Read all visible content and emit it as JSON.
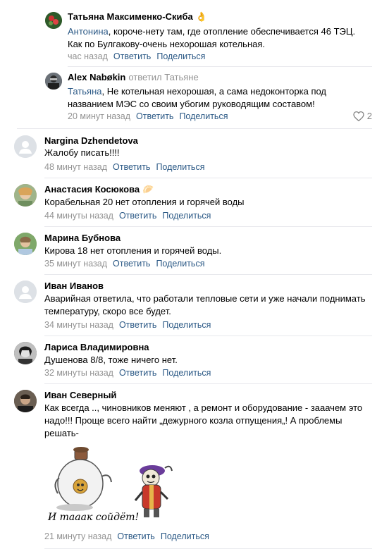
{
  "comments": [
    {
      "author": "Татьяна Максименко-Скиба",
      "emoji": "👌",
      "mention": "Антонина",
      "text_line1": ", короче-нету там, где отопление обеспечивается 46 ТЭЦ.",
      "text_line2": "Как по Булгакову-очень нехорошая котельная.",
      "time": "час назад",
      "reply_label": "Ответить",
      "share_label": "Поделиться"
    },
    {
      "author": "Alex Nabøkin",
      "replied_to": "ответил Татьяне",
      "mention": "Татьяна",
      "text_line1": ", Не котельная нехорошая, а сама недоконторка под",
      "text_line2": "названием МЭС со своим убогим руководящим составом!",
      "time": "20 минут назад",
      "reply_label": "Ответить",
      "share_label": "Поделиться",
      "likes": "2"
    },
    {
      "author": "Nargina Dzhendetova",
      "text_line1": "Жалобу писать!!!!",
      "time": "48 минут назад",
      "reply_label": "Ответить",
      "share_label": "Поделиться"
    },
    {
      "author": "Анастасия Косюкова",
      "emoji": "🥟",
      "text_line1": "Корабельная 20 нет отопления и горячей воды",
      "time": "44 минуты назад",
      "reply_label": "Ответить",
      "share_label": "Поделиться"
    },
    {
      "author": "Марина Бубнова",
      "text_line1": "Кирова 18 нет отопления и горячей воды.",
      "time": "35 минут назад",
      "reply_label": "Ответить",
      "share_label": "Поделиться"
    },
    {
      "author": "Иван Иванов",
      "text_line1": "Аварийная ответила, что работали тепловые сети и уже начали поднимать",
      "text_line2": "температуру, скоро все будет.",
      "time": "34 минуты назад",
      "reply_label": "Ответить",
      "share_label": "Поделиться"
    },
    {
      "author": "Лариса Владимировна",
      "text_line1": "Душенова 8/8, тоже ничего нет.",
      "time": "32 минуты назад",
      "reply_label": "Ответить",
      "share_label": "Поделиться"
    },
    {
      "author": "Иван Северный",
      "text_line1": "Как всегда .., чиновников меняют , а ремонт и оборудование - зааачем это",
      "text_line2": "надо!!! Проще всего найти „дежурного козла отпущения„! А проблемы",
      "text_line3": "решать-",
      "sticker_caption": "И тааак сойдёт!",
      "time": "21 минуту назад",
      "reply_label": "Ответить",
      "share_label": "Поделиться"
    }
  ],
  "colors": {
    "link": "#2a5885",
    "meta": "#939393",
    "separator": "#e7e8ec"
  }
}
